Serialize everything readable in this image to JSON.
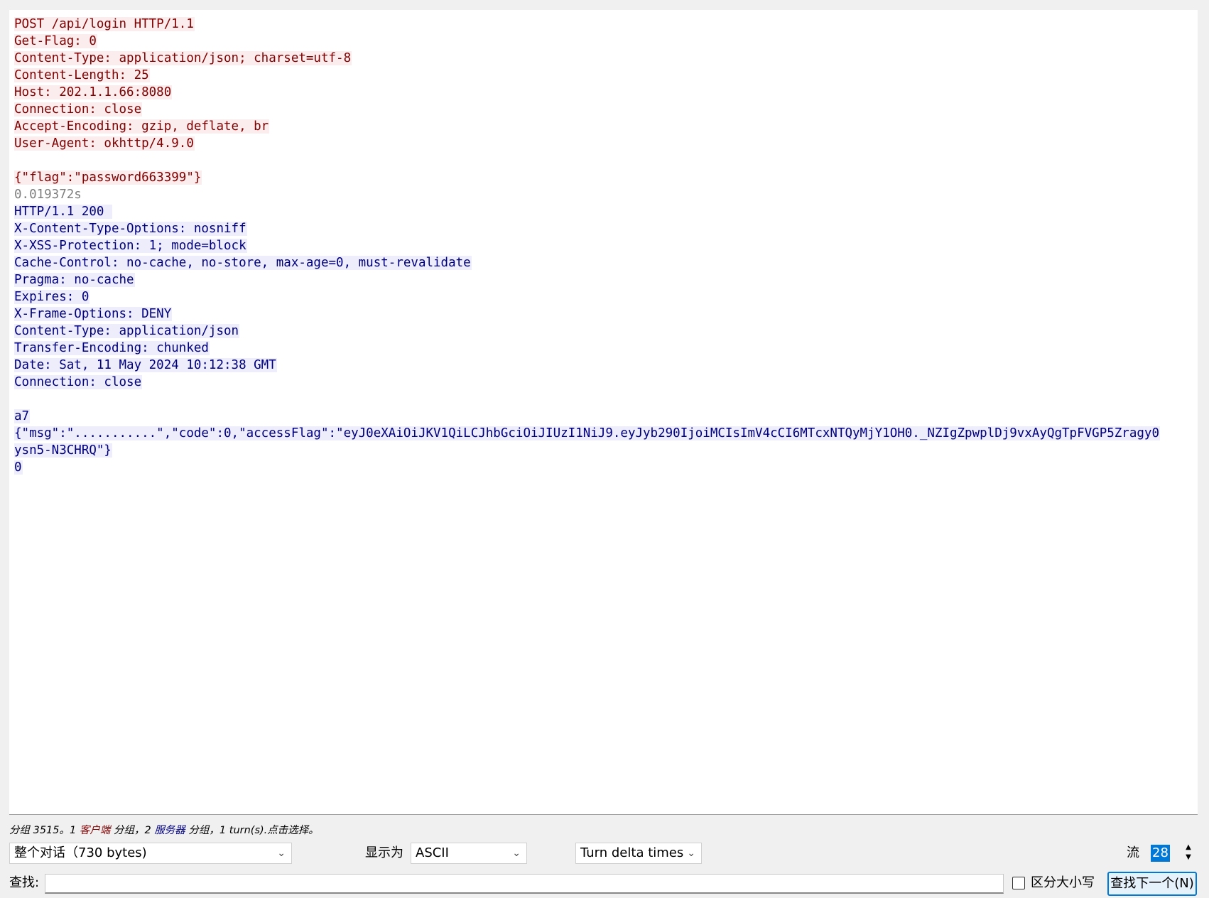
{
  "client_lines": [
    "POST /api/login HTTP/1.1",
    "Get-Flag: 0",
    "Content-Type: application/json; charset=utf-8",
    "Content-Length: 25",
    "Host: 202.1.1.66:8080",
    "Connection: close",
    "Accept-Encoding: gzip, deflate, br",
    "User-Agent: okhttp/4.9.0",
    "",
    "{\"flag\":\"password663399\"}"
  ],
  "delta_time": "0.019372s",
  "server_lines": [
    "HTTP/1.1 200 ",
    "X-Content-Type-Options: nosniff",
    "X-XSS-Protection: 1; mode=block",
    "Cache-Control: no-cache, no-store, max-age=0, must-revalidate",
    "Pragma: no-cache",
    "Expires: 0",
    "X-Frame-Options: DENY",
    "Content-Type: application/json",
    "Transfer-Encoding: chunked",
    "Date: Sat, 11 May 2024 10:12:38 GMT",
    "Connection: close",
    "",
    "a7",
    "{\"msg\":\"...........\",\"code\":0,\"accessFlag\":\"eyJ0eXAiOiJKV1QiLCJhbGciOiJIUzI1NiJ9.eyJyb290IjoiMCIsImV4cCI6MTcxNTQyMjY1OH0._NZIgZpwplDj9vxAyQgTpFVGP5Zragy0",
    "ysn5-N3CHRQ\"}",
    "0"
  ],
  "status": {
    "prefix": "分组 3515。1 ",
    "client_word": "客户端",
    "mid": " 分组，2 ",
    "server_word": "服务器",
    "suffix": " 分组，1 turn(s).点击选择。"
  },
  "controls": {
    "conversation_select": "整个对话（730 bytes)",
    "show_as_label": "显示为",
    "show_as_value": "ASCII",
    "delta_select": "Turn delta times",
    "stream_label": "流",
    "stream_value": "28",
    "find_label": "查找:",
    "find_value": "",
    "case_label": "区分大小写",
    "find_next": "查找下一个(N)"
  },
  "colors": {
    "client_text": "#7f0000",
    "client_bg": "#fbeded",
    "server_text": "#00007f",
    "server_bg": "#ededfb",
    "accent": "#0078d7"
  }
}
